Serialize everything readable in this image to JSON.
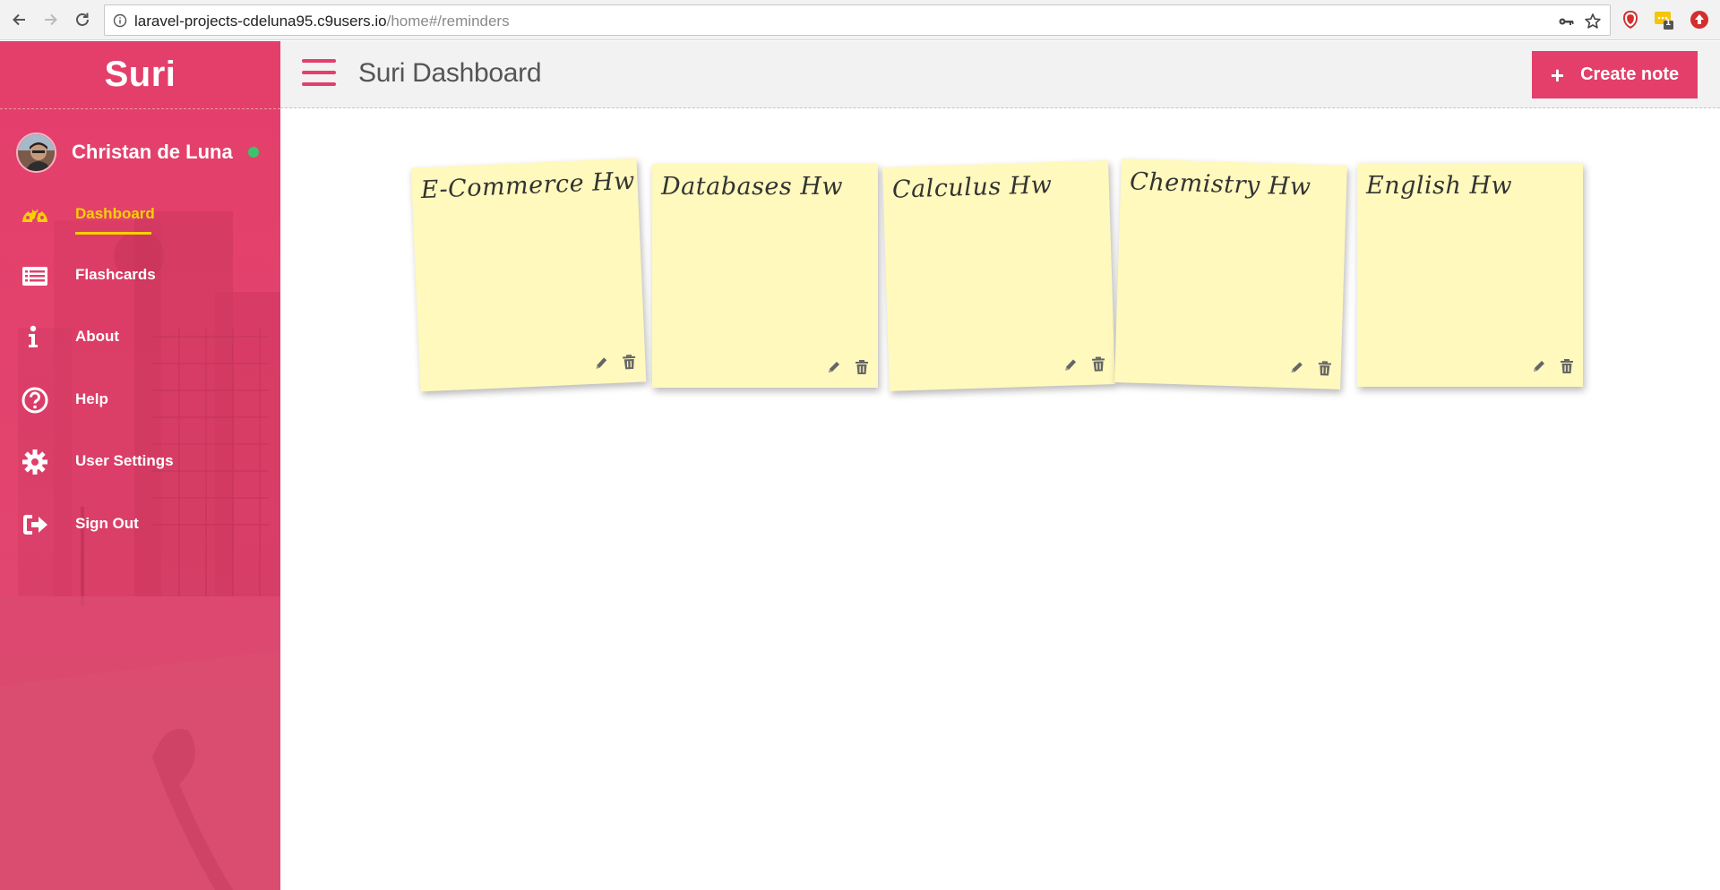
{
  "browser": {
    "url_host": "laravel-projects-cdeluna95.c9users.io",
    "url_path": "/home#/reminders",
    "extension_badge": "1"
  },
  "sidebar": {
    "brand": "Suri",
    "user_name": "Christan de Luna",
    "items": [
      {
        "label": "Dashboard",
        "icon": "dashboard-icon",
        "active": true
      },
      {
        "label": "Flashcards",
        "icon": "flashcards-icon",
        "active": false
      },
      {
        "label": "About",
        "icon": "info-icon",
        "active": false
      },
      {
        "label": "Help",
        "icon": "help-icon",
        "active": false
      },
      {
        "label": "User Settings",
        "icon": "gear-icon",
        "active": false
      },
      {
        "label": "Sign Out",
        "icon": "sign-out-icon",
        "active": false
      }
    ]
  },
  "header": {
    "title": "Suri Dashboard",
    "create_label": "Create note"
  },
  "notes": [
    {
      "title": "E-Commerce Hw"
    },
    {
      "title": "Databases Hw"
    },
    {
      "title": "Calculus Hw"
    },
    {
      "title": "Chemistry Hw"
    },
    {
      "title": "English Hw"
    }
  ],
  "colors": {
    "accent": "#e33f6a",
    "active_nav": "#f7d000",
    "note_bg": "#fff9bd",
    "online": "#3cc36b"
  }
}
